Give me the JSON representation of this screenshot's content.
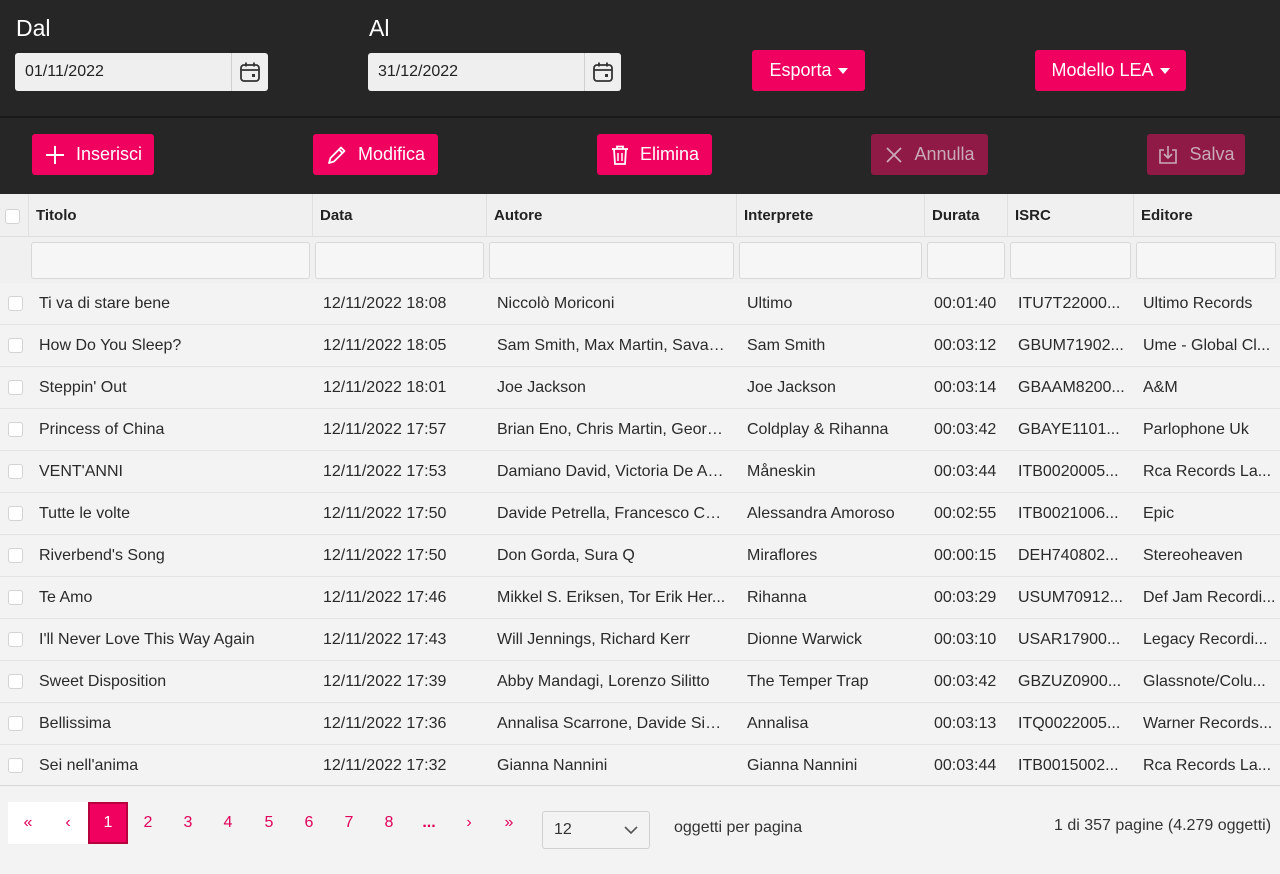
{
  "date_range": {
    "from_label": "Dal",
    "from_value": "01/11/2022",
    "to_label": "Al",
    "to_value": "31/12/2022"
  },
  "top_actions": {
    "export_label": "Esporta",
    "model_label": "Modello LEA"
  },
  "toolbar": {
    "insert_label": "Inserisci",
    "edit_label": "Modifica",
    "delete_label": "Elimina",
    "cancel_label": "Annulla",
    "save_label": "Salva"
  },
  "columns": [
    "Titolo",
    "Data",
    "Autore",
    "Interprete",
    "Durata",
    "ISRC",
    "Editore"
  ],
  "rows": [
    [
      "Ti va di stare bene",
      "12/11/2022 18:08",
      "Niccolò Moriconi",
      "Ultimo",
      "00:01:40",
      "ITU7T22000...",
      "Ultimo Records"
    ],
    [
      "How Do You Sleep?",
      "12/11/2022 18:05",
      "Sam Smith, Max Martin, Savan...",
      "Sam Smith",
      "00:03:12",
      "GBUM71902...",
      "Ume - Global Cl..."
    ],
    [
      "Steppin' Out",
      "12/11/2022 18:01",
      "Joe Jackson",
      "Joe Jackson",
      "00:03:14",
      "GBAAM8200...",
      "A&M"
    ],
    [
      "Princess of China",
      "12/11/2022 17:57",
      "Brian Eno, Chris Martin, Georg ...",
      "Coldplay & Rihanna",
      "00:03:42",
      "GBAYE1101...",
      "Parlophone Uk"
    ],
    [
      "VENT'ANNI",
      "12/11/2022 17:53",
      "Damiano David, Victoria De An...",
      "Måneskin",
      "00:03:44",
      "ITB0020005...",
      "Rca Records La..."
    ],
    [
      "Tutte le volte",
      "12/11/2022 17:50",
      "Davide Petrella, Francesco Cati...",
      "Alessandra Amoroso",
      "00:02:55",
      "ITB0021006...",
      "Epic"
    ],
    [
      "Riverbend's Song",
      "12/11/2022 17:50",
      "Don Gorda, Sura Q",
      "Miraflores",
      "00:00:15",
      "DEH740802...",
      "Stereoheaven"
    ],
    [
      "Te Amo",
      "12/11/2022 17:46",
      "Mikkel S. Eriksen, Tor Erik Her...",
      "Rihanna",
      "00:03:29",
      "USUM70912...",
      "Def Jam Recordi..."
    ],
    [
      "I'll Never Love This Way Again",
      "12/11/2022 17:43",
      "Will Jennings, Richard Kerr",
      "Dionne Warwick",
      "00:03:10",
      "USAR17900...",
      "Legacy Recordi..."
    ],
    [
      "Sweet Disposition",
      "12/11/2022 17:39",
      "Abby Mandagi, Lorenzo Silitto",
      "The Temper Trap",
      "00:03:42",
      "GBZUZ0900...",
      "Glassnote/Colu..."
    ],
    [
      "Bellissima",
      "12/11/2022 17:36",
      "Annalisa Scarrone, Davide Sim...",
      "Annalisa",
      "00:03:13",
      "ITQ0022005...",
      "Warner Records..."
    ],
    [
      "Sei nell'anima",
      "12/11/2022 17:32",
      "Gianna Nannini",
      "Gianna Nannini",
      "00:03:44",
      "ITB0015002...",
      "Rca Records La..."
    ]
  ],
  "pager": {
    "first": "«",
    "prev": "‹",
    "pages": [
      "1",
      "2",
      "3",
      "4",
      "5",
      "6",
      "7",
      "8",
      "..."
    ],
    "active_page": "1",
    "next": "›",
    "last": "»",
    "per_page_value": "12",
    "per_page_label": "oggetti per pagina",
    "summary": "1 di 357 pagine (4.279 oggetti)"
  },
  "colors": {
    "accent": "#f0005f",
    "accent_disabled": "#8e1a45",
    "dark_bg": "#262626"
  },
  "icons": [
    "calendar-icon",
    "plus-icon",
    "pencil-icon",
    "trash-icon",
    "x-icon",
    "save-download-icon",
    "chevron-down-icon"
  ]
}
